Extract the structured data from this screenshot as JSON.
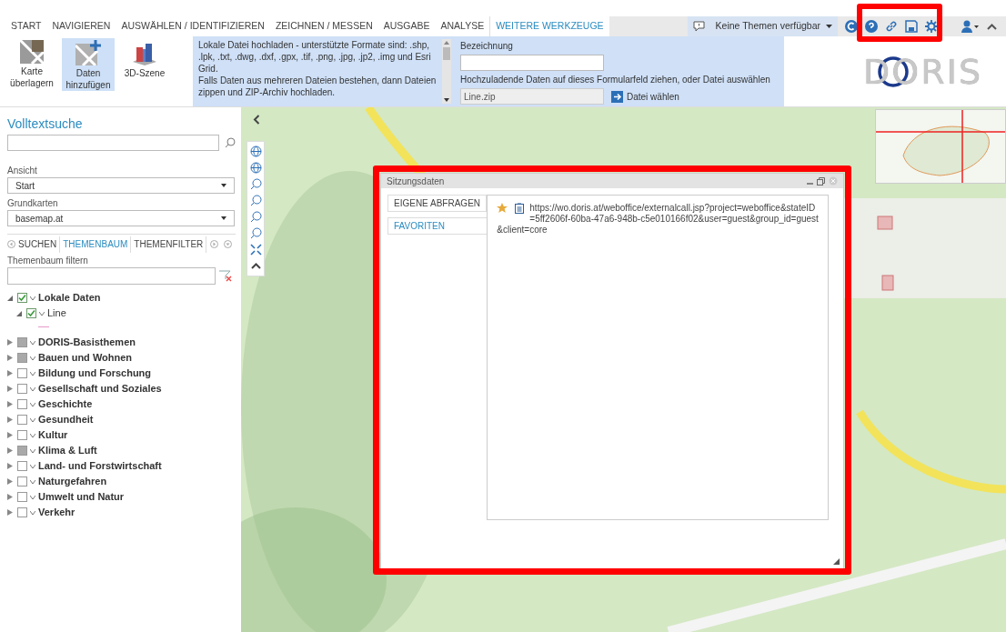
{
  "menu_tabs": [
    {
      "label": "START",
      "selected": false
    },
    {
      "label": "NAVIGIEREN",
      "selected": false
    },
    {
      "label": "AUSWÄHLEN / IDENTIFIZIEREN",
      "selected": false
    },
    {
      "label": "ZEICHNEN / MESSEN",
      "selected": false
    },
    {
      "label": "AUSGABE",
      "selected": false
    },
    {
      "label": "ANALYSE",
      "selected": false
    },
    {
      "label": "WEITERE WERKZEUGE",
      "selected": true
    }
  ],
  "topbar": {
    "themes_dropdown": "Keine Themen verfügbar"
  },
  "ribbon": {
    "tools": [
      {
        "label": "Karte überlagern",
        "kind": "overlay",
        "selected": false
      },
      {
        "label": "Daten hinzufügen",
        "kind": "add",
        "selected": true
      },
      {
        "label": "3D-Szene",
        "kind": "scene",
        "selected": false
      }
    ],
    "description": [
      "Lokale Datei hochladen - unterstützte Formate sind: .shp, .lpk, .txt, .dwg, .dxf, .gpx, .tif, .png, .jpg, .jp2, .img und Esri Grid.",
      "Falls Daten aus mehreren Dateien bestehen, dann Dateien zippen und ZIP-Archiv hochladen."
    ],
    "name_label": "Bezeichnung",
    "drop_hint": "Hochzuladende Daten auf dieses Formularfeld ziehen, oder Datei auswählen",
    "file_value": "Line.zip",
    "choose_button": "Datei wählen"
  },
  "logo": "DORIS",
  "sidebar": {
    "search_title": "Volltextsuche",
    "view_label": "Ansicht",
    "view_value": "Start",
    "basemap_label": "Grundkarten",
    "basemap_value": "basemap.at",
    "panel_tabs": [
      {
        "label": "SUCHEN",
        "selected": false
      },
      {
        "label": "THEMENBAUM",
        "selected": true
      },
      {
        "label": "THEMENFILTER",
        "selected": false
      }
    ],
    "filter_label": "Themenbaum filtern",
    "tree": [
      {
        "label": "Lokale Daten",
        "checked": true,
        "expanded": true,
        "children": [
          {
            "label": "Line",
            "checked": true,
            "expanded": true,
            "legend": true
          }
        ]
      },
      {
        "label": "DORIS-Basisthemen",
        "checked": false,
        "partial": true,
        "expanded": false
      },
      {
        "label": "Bauen und Wohnen",
        "checked": false,
        "partial": true,
        "expanded": false
      },
      {
        "label": "Bildung und Forschung",
        "checked": false,
        "expanded": false
      },
      {
        "label": "Gesellschaft und Soziales",
        "checked": false,
        "expanded": false
      },
      {
        "label": "Geschichte",
        "checked": false,
        "expanded": false
      },
      {
        "label": "Gesundheit",
        "checked": false,
        "expanded": false
      },
      {
        "label": "Kultur",
        "checked": false,
        "expanded": false
      },
      {
        "label": "Klima & Luft",
        "checked": false,
        "partial": true,
        "expanded": false
      },
      {
        "label": "Land- und Forstwirtschaft",
        "checked": false,
        "expanded": false
      },
      {
        "label": "Naturgefahren",
        "checked": false,
        "expanded": false
      },
      {
        "label": "Umwelt und Natur",
        "checked": false,
        "expanded": false
      },
      {
        "label": "Verkehr",
        "checked": false,
        "expanded": false
      }
    ]
  },
  "dialog": {
    "title": "Sitzungsdaten",
    "tabs": [
      {
        "label": "EIGENE ABFRAGEN",
        "selected": false
      },
      {
        "label": "FAVORITEN",
        "selected": true
      }
    ],
    "favorites": [
      {
        "url": "https://wo.doris.at/weboffice/externalcall.jsp?project=weboffice&stateID=5ff2606f-60ba-47a6-948b-c5e010166f02&user=guest&group_id=guest&client=core"
      }
    ]
  }
}
